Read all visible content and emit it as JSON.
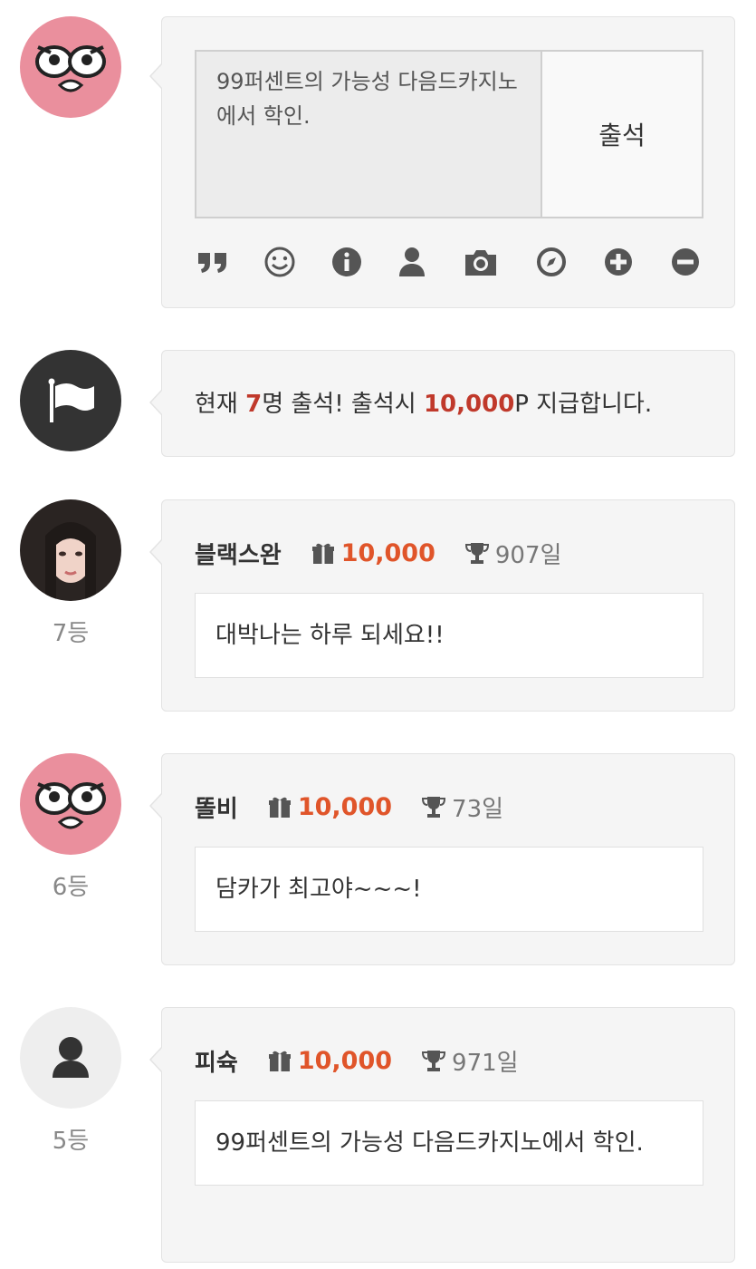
{
  "compose": {
    "text": "99퍼센트의 가능성 다음드카지노에서 학인.",
    "button_label": "출석",
    "tools": [
      "quote-icon",
      "smile-icon",
      "info-icon",
      "user-icon",
      "camera-icon",
      "compass-icon",
      "plus-icon",
      "minus-icon"
    ]
  },
  "notice": {
    "prefix": "현재 ",
    "count": "7",
    "mid": "명 출석! 출석시 ",
    "points": "10,000",
    "suffix": "P 지급합니다."
  },
  "comments": [
    {
      "rank": "7등",
      "nickname": "블랙스완",
      "points": "10,000",
      "days": "907일",
      "message": "대박나는 하루 되세요!!"
    },
    {
      "rank": "6등",
      "nickname": "똘비",
      "points": "10,000",
      "days": "73일",
      "message": "담카가 최고야~~~!"
    },
    {
      "rank": "5등",
      "nickname": "피슉",
      "points": "10,000",
      "days": "971일",
      "message": "99퍼센트의 가능성 다음드카지노에서 학인."
    }
  ],
  "colors": {
    "accent_points": "#e0552a",
    "notice_red": "#c0392b",
    "panel_bg": "#f5f5f5"
  }
}
